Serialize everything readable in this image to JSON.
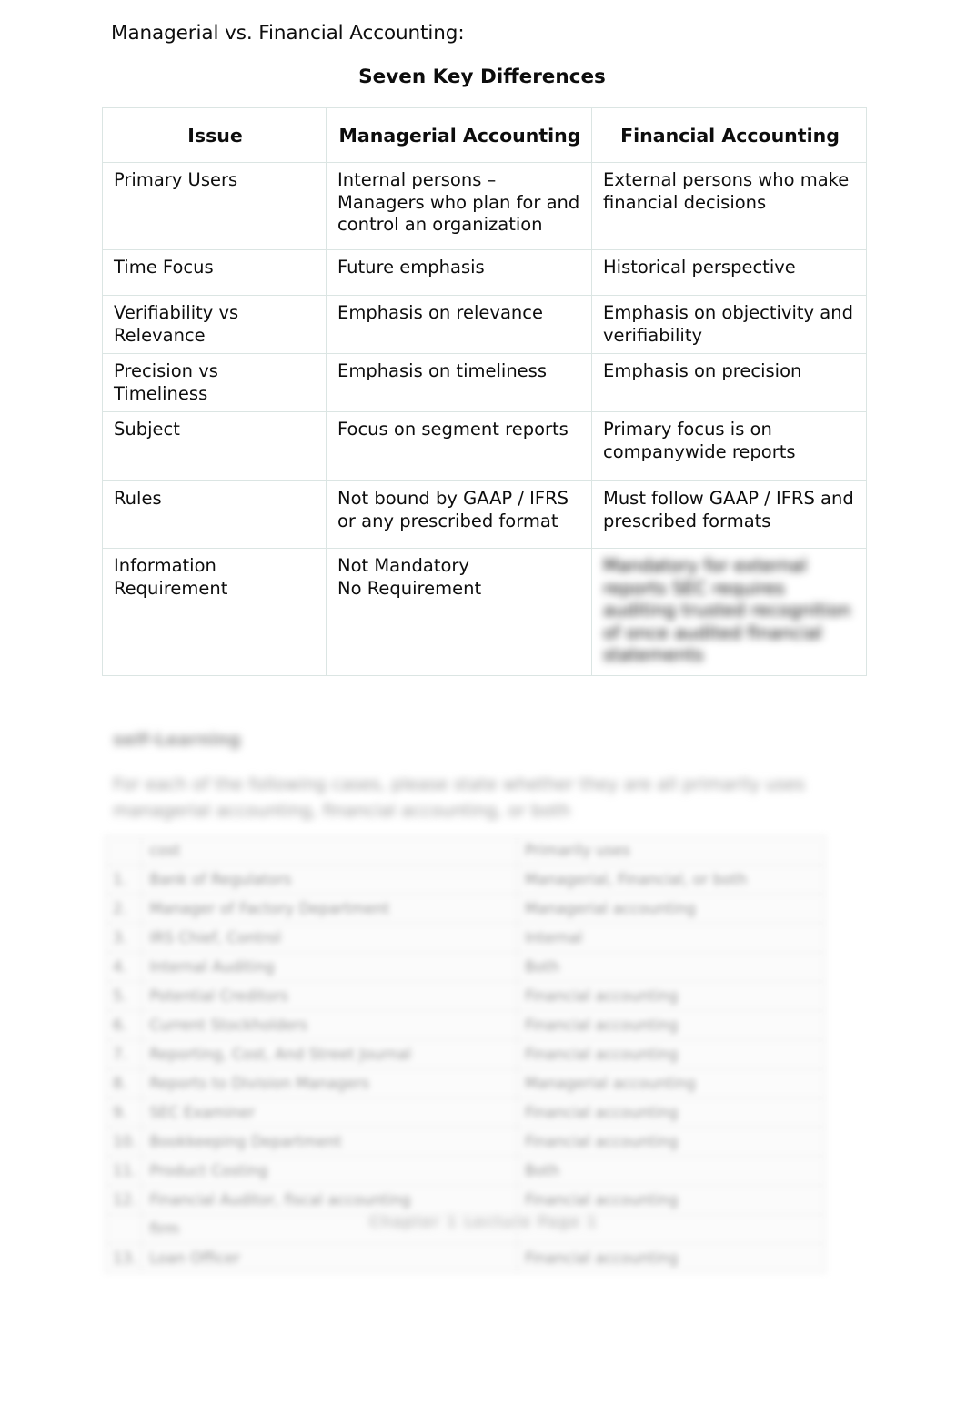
{
  "document": {
    "title_line": "Managerial vs. Financial Accounting:",
    "subtitle": "Seven Key Differences"
  },
  "comparison_table": {
    "headers": {
      "issue": "Issue",
      "managerial": "Managerial Accounting",
      "financial": "Financial Accounting"
    },
    "rows": [
      {
        "issue": "Primary Users",
        "managerial": "Internal persons – Managers who plan for and control an organization",
        "financial": "External persons who make financial decisions"
      },
      {
        "issue": "Time Focus",
        "managerial": "Future emphasis",
        "financial": "Historical perspective"
      },
      {
        "issue": "Verifiability vs Relevance",
        "managerial": "Emphasis on relevance",
        "financial": "Emphasis on objectivity and verifiability"
      },
      {
        "issue": "Precision vs Timeliness",
        "managerial": "Emphasis on timeliness",
        "financial": "Emphasis on precision"
      },
      {
        "issue": "Subject",
        "managerial": "Focus on segment reports",
        "financial": "Primary focus is on companywide reports"
      },
      {
        "issue": "Rules",
        "managerial": "Not bound by GAAP / IFRS or any prescribed format",
        "financial": "Must follow GAAP / IFRS and prescribed formats"
      },
      {
        "issue": "Information Requirement",
        "managerial": "Not Mandatory\nNo Requirement",
        "financial": "Mandatory for external reports SEC requires auditing trusted recognition of once audited financial statements"
      }
    ]
  },
  "exercise_section": {
    "heading": "self-Learning",
    "instructions": "For each of the following cases, please state whether they are all primarily uses managerial accounting, financial accounting, or both"
  },
  "exercise_table": {
    "rows": [
      {
        "num": "",
        "item": "cost",
        "answer": "Primarily uses"
      },
      {
        "num": "1.",
        "item": "Bank of Regulators",
        "answer": "Managerial, Financial, or both"
      },
      {
        "num": "2.",
        "item": "Manager of Factory Department",
        "answer": "Managerial accounting"
      },
      {
        "num": "3.",
        "item": "IRS Chief, Control",
        "answer": "Internal"
      },
      {
        "num": "4.",
        "item": "Internal Auditing",
        "answer": "Both"
      },
      {
        "num": "5.",
        "item": "Potential Creditors",
        "answer": "Financial accounting"
      },
      {
        "num": "6.",
        "item": "Current Stockholders",
        "answer": "Financial accounting"
      },
      {
        "num": "7.",
        "item": "Reporting, Cost, And Street Journal",
        "answer": "Financial accounting"
      },
      {
        "num": "8.",
        "item": "Reports to Division Managers",
        "answer": "Managerial accounting"
      },
      {
        "num": "9.",
        "item": "SEC Examiner",
        "answer": "Financial accounting"
      },
      {
        "num": "10.",
        "item": "Bookkeeping Department",
        "answer": "Financial accounting"
      },
      {
        "num": "11.",
        "item": "Product Costing",
        "answer": "Both"
      },
      {
        "num": "12.",
        "item": "Financial Auditor, fiscal accounting",
        "answer": "Financial accounting"
      },
      {
        "num": "",
        "item": "firm",
        "answer": ""
      },
      {
        "num": "13.",
        "item": "Loan Officer",
        "answer": "Financial accounting"
      }
    ]
  },
  "footer": {
    "text": "Chapter 1 Lecture Page 1"
  }
}
